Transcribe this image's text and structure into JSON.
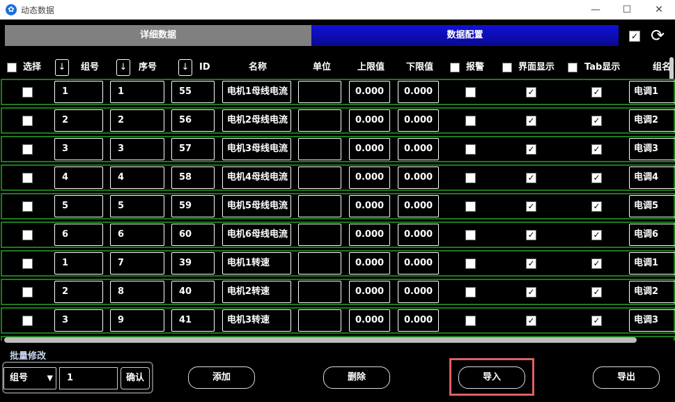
{
  "window": {
    "title": "动态数据",
    "icon": "app-icon",
    "minimize": "—",
    "maximize": "☐",
    "close": "✕"
  },
  "tabs": {
    "detail": "详细数据",
    "config": "数据配置"
  },
  "toolbar": {
    "select_all_checked": "✓",
    "refresh_icon": "⟳"
  },
  "columns": {
    "select": "选择",
    "group": "组号",
    "seq": "序号",
    "id": "ID",
    "name": "名称",
    "unit": "单位",
    "upper": "上限值",
    "lower": "下限值",
    "alarm": "报警",
    "display": "界面显示",
    "tab": "Tab显示",
    "groupname": "组名",
    "sort_arrow": "↓"
  },
  "check_mark": "✓",
  "rows": [
    {
      "group": "1",
      "seq": "1",
      "id": "55",
      "name": "电机1母线电流",
      "unit": "",
      "upper": "0.000",
      "lower": "0.000",
      "alarm": false,
      "display": true,
      "tab": true,
      "groupname": "电调1"
    },
    {
      "group": "2",
      "seq": "2",
      "id": "56",
      "name": "电机2母线电流",
      "unit": "",
      "upper": "0.000",
      "lower": "0.000",
      "alarm": false,
      "display": true,
      "tab": true,
      "groupname": "电调2"
    },
    {
      "group": "3",
      "seq": "3",
      "id": "57",
      "name": "电机3母线电流",
      "unit": "",
      "upper": "0.000",
      "lower": "0.000",
      "alarm": false,
      "display": true,
      "tab": true,
      "groupname": "电调3"
    },
    {
      "group": "4",
      "seq": "4",
      "id": "58",
      "name": "电机4母线电流",
      "unit": "",
      "upper": "0.000",
      "lower": "0.000",
      "alarm": false,
      "display": true,
      "tab": true,
      "groupname": "电调4"
    },
    {
      "group": "5",
      "seq": "5",
      "id": "59",
      "name": "电机5母线电流",
      "unit": "",
      "upper": "0.000",
      "lower": "0.000",
      "alarm": false,
      "display": true,
      "tab": true,
      "groupname": "电调5"
    },
    {
      "group": "6",
      "seq": "6",
      "id": "60",
      "name": "电机6母线电流",
      "unit": "",
      "upper": "0.000",
      "lower": "0.000",
      "alarm": false,
      "display": true,
      "tab": true,
      "groupname": "电调6"
    },
    {
      "group": "1",
      "seq": "7",
      "id": "39",
      "name": "电机1转速",
      "unit": "",
      "upper": "0.000",
      "lower": "0.000",
      "alarm": false,
      "display": true,
      "tab": true,
      "groupname": "电调1"
    },
    {
      "group": "2",
      "seq": "8",
      "id": "40",
      "name": "电机2转速",
      "unit": "",
      "upper": "0.000",
      "lower": "0.000",
      "alarm": false,
      "display": true,
      "tab": true,
      "groupname": "电调2"
    },
    {
      "group": "3",
      "seq": "9",
      "id": "41",
      "name": "电机3转速",
      "unit": "",
      "upper": "0.000",
      "lower": "0.000",
      "alarm": false,
      "display": true,
      "tab": true,
      "groupname": "电调3"
    }
  ],
  "batch": {
    "label": "批量修改",
    "field": "组号",
    "value": "1",
    "confirm": "确认",
    "caret": "▼"
  },
  "actions": {
    "add": "添加",
    "delete": "删除",
    "import": "导入",
    "export": "导出"
  }
}
